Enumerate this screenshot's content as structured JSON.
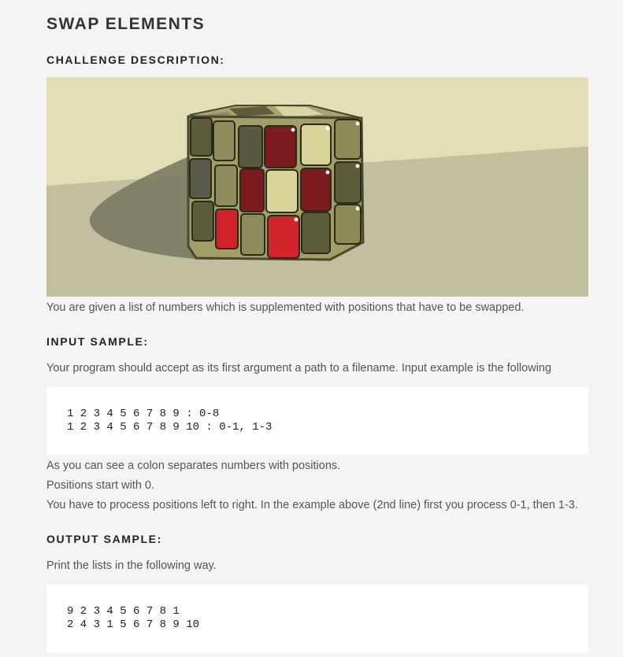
{
  "title": "SWAP ELEMENTS",
  "sections": {
    "challenge": {
      "heading": "CHALLENGE DESCRIPTION:"
    },
    "input": {
      "heading": "INPUT SAMPLE:"
    },
    "output": {
      "heading": "OUTPUT SAMPLE:"
    }
  },
  "text": {
    "description": "You are given a list of numbers which is supplemented with positions that have to be swapped.",
    "input_intro": "Your program should accept as its first argument a path to a filename. Input example is the following",
    "note1": "As you can see a colon separates numbers with positions.",
    "note2": "Positions start with 0.",
    "note3": "You have to process positions left to right. In the example above (2nd line) first you process 0-1, then 1-3.",
    "output_intro": "Print the lists in the following way."
  },
  "input_code": "1 2 3 4 5 6 7 8 9 : 0-8\n1 2 3 4 5 6 7 8 9 10 : 0-1, 1-3",
  "output_code": "9 2 3 4 5 6 7 8 1\n2 4 3 1 5 6 7 8 9 10",
  "image": {
    "subject": "rubiks-cube-illustration"
  },
  "colors": {
    "page_background": "#f4f4f4",
    "wall": "#e2dfb6",
    "floor": "#c2bf9e",
    "cube_frame": "#9d9c66",
    "cube_red": "#d1242a",
    "cube_dark_red": "#7c1c1e",
    "cube_cream": "#d8d49a"
  }
}
